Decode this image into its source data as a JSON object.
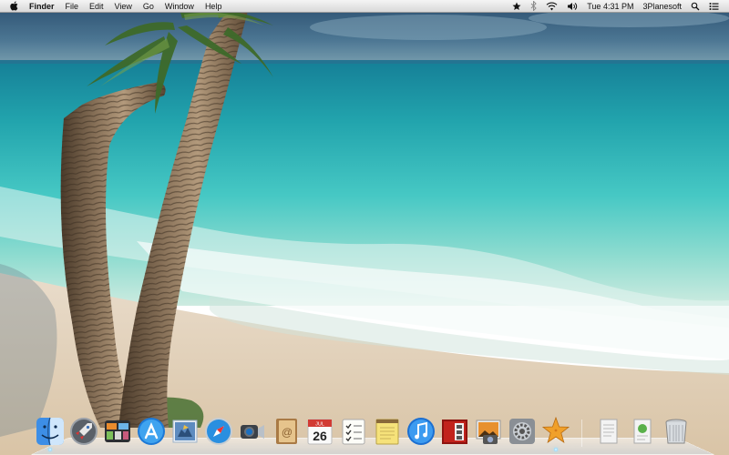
{
  "menubar": {
    "app_name": "Finder",
    "menus": [
      "File",
      "Edit",
      "View",
      "Go",
      "Window",
      "Help"
    ],
    "clock": "Tue 4:31 PM",
    "user": "3Planesoft"
  },
  "dock": {
    "apps": [
      {
        "name": "Finder",
        "icon": "finder-icon",
        "running": true
      },
      {
        "name": "Launchpad",
        "icon": "launchpad-icon",
        "running": false
      },
      {
        "name": "Mission Control",
        "icon": "mission-control-icon",
        "running": false
      },
      {
        "name": "App Store",
        "icon": "app-store-icon",
        "running": false
      },
      {
        "name": "Mail",
        "icon": "mail-icon",
        "running": false
      },
      {
        "name": "Safari",
        "icon": "safari-icon",
        "running": false
      },
      {
        "name": "FaceTime",
        "icon": "facetime-icon",
        "running": false
      },
      {
        "name": "Address Book",
        "icon": "address-book-icon",
        "running": false
      },
      {
        "name": "iCal",
        "icon": "calendar-icon",
        "running": false,
        "date": "26",
        "month": "JUL"
      },
      {
        "name": "Reminders",
        "icon": "reminders-icon",
        "running": false
      },
      {
        "name": "Notes",
        "icon": "notes-icon",
        "running": false
      },
      {
        "name": "iTunes",
        "icon": "itunes-icon",
        "running": false
      },
      {
        "name": "Photo Booth",
        "icon": "photo-booth-icon",
        "running": false
      },
      {
        "name": "iPhoto",
        "icon": "iphoto-icon",
        "running": false
      },
      {
        "name": "System Preferences",
        "icon": "system-preferences-icon",
        "running": false
      },
      {
        "name": "Beach Screensaver",
        "icon": "starfish-icon",
        "running": true
      }
    ],
    "stacks": [
      {
        "name": "Documents",
        "icon": "documents-stack-icon"
      },
      {
        "name": "Downloads",
        "icon": "downloads-stack-icon"
      },
      {
        "name": "Trash",
        "icon": "trash-icon"
      }
    ]
  },
  "colors": {
    "sky": "#2c5a7a",
    "sea_deep": "#1f8fa0",
    "sea_shallow": "#4fd0c9",
    "sand": "#e7d8c0",
    "menubar": "#e6e6e6"
  }
}
